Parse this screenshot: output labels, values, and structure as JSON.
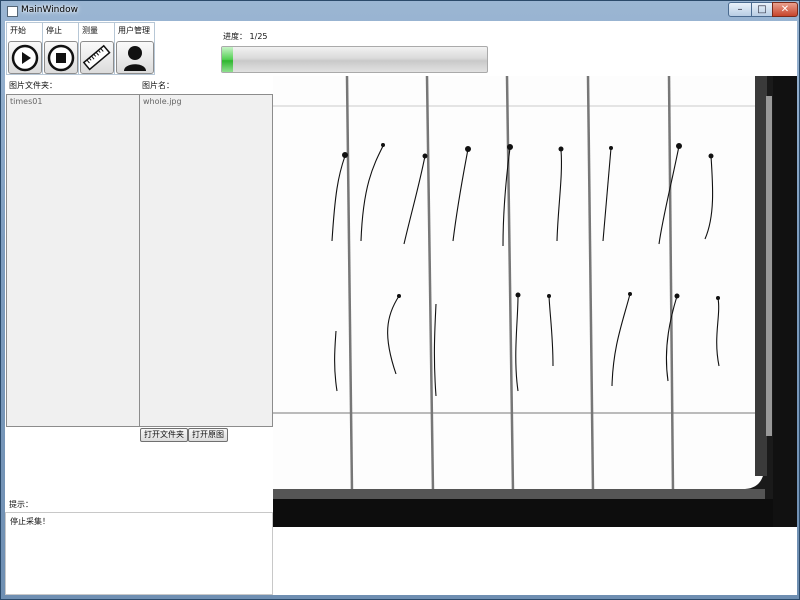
{
  "window": {
    "title": "MainWindow",
    "minimize_icon": "minimize-icon",
    "maximize_icon": "maximize-icon",
    "close_icon": "close-icon"
  },
  "toolbar": {
    "start_label": "开始",
    "stop_label": "停止",
    "measure_label": "测量",
    "user_label": "用户管理",
    "icons": [
      "play-icon",
      "stop-icon",
      "ruler-icon",
      "user-icon"
    ]
  },
  "progress": {
    "label": "进度：",
    "text": "1/25",
    "fraction": 0.04,
    "bar_color": "#3cc13c"
  },
  "folder_panel": {
    "label": "图片文件夹：",
    "items": [
      "times01"
    ]
  },
  "image_panel": {
    "label": "图片名：",
    "items": [
      "whole.jpg"
    ]
  },
  "buttons": {
    "open_folder": "打开文件夹",
    "open_original": "打开原图"
  },
  "hint": {
    "label": "提示：",
    "message": "停止采集！"
  },
  "image_view": {
    "description_icon": "seedling-scan-image"
  }
}
